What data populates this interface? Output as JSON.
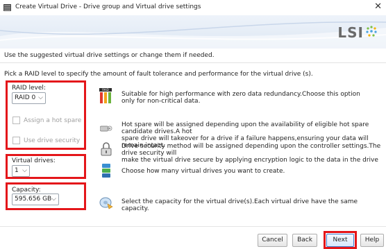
{
  "window": {
    "title": "Create Virtual Drive - Drive group and Virtual drive settings",
    "close_glyph": "✕"
  },
  "banner": {
    "logo_text": "LSI"
  },
  "intro_text": "Use the suggested virtual drive settings or change them if needed.",
  "pick_text": "Pick a RAID level to specify the amount of fault tolerance and performance for the virtual drive (s).",
  "raid": {
    "label": "RAID level:",
    "value": "RAID 0",
    "description_line1": "Suitable for high performance with zero data redundancy.Choose this option",
    "description_line2": "only for non-critical data."
  },
  "hot_spare": {
    "label": "Assign a hot spare",
    "description_line1": "Hot spare will be assigned depending upon the availability of eligible hot spare candidate drives.A hot",
    "description_line2": "spare drive will takeover for a drive if a failure happens,ensuring your data will remain intact."
  },
  "drive_security": {
    "label": "Use drive security",
    "description_line1": "Drive security method will be assigned depending upon the controller settings.The drive security will",
    "description_line2": "make the virtual drive secure by applying encryption logic to the data in the drive"
  },
  "virtual_drives": {
    "label": "Virtual drives:",
    "value": "1",
    "description": "Choose how many virtual drives you want to create."
  },
  "capacity": {
    "label": "Capacity:",
    "value": "595.656 GB",
    "description": "Select the capacity for the virtual drive(s).Each virtual drive have the same capacity."
  },
  "buttons": {
    "cancel": "Cancel",
    "back": "Back",
    "next": "Next",
    "help": "Help"
  },
  "colors": {
    "highlight": "#e4161a",
    "accent": "#3d7bd0"
  }
}
